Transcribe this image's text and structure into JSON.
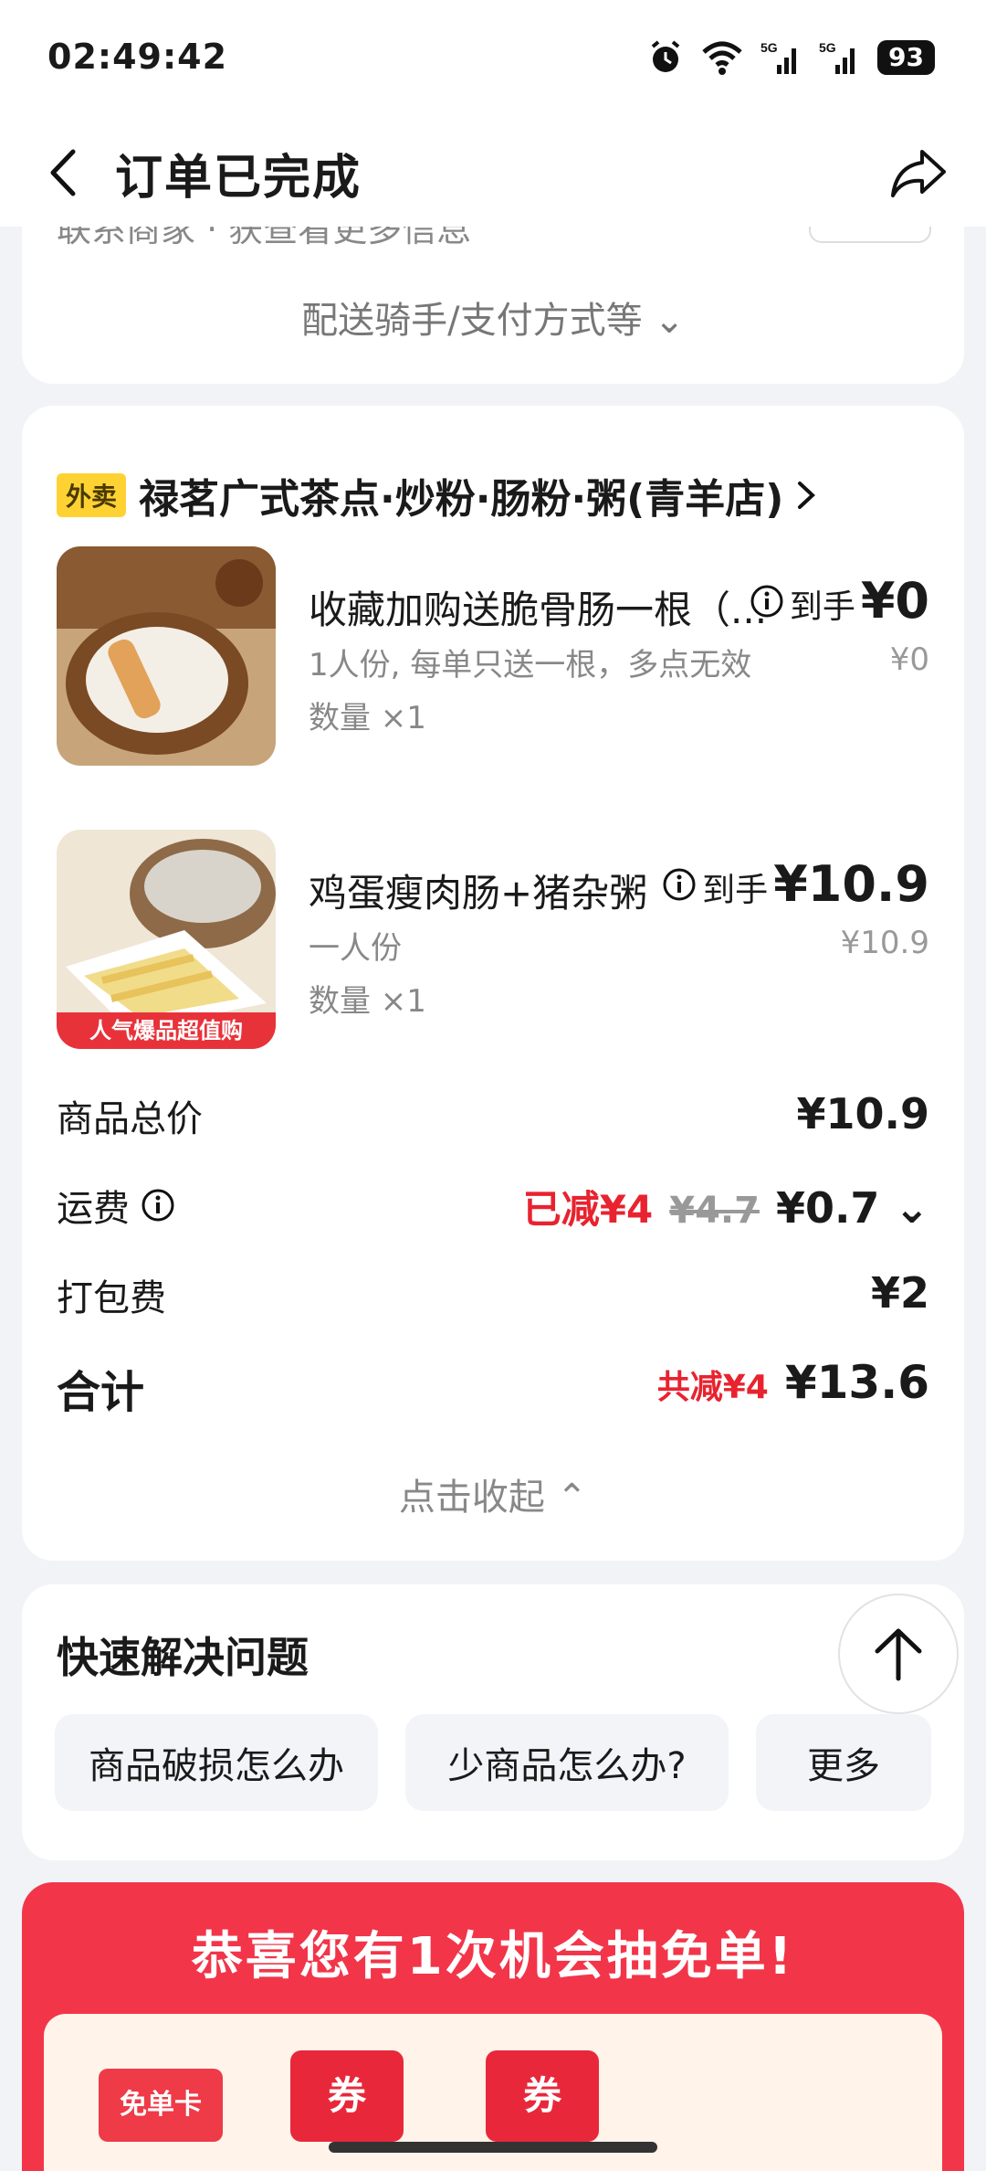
{
  "status_bar": {
    "time": "02:49:42",
    "battery": "93",
    "signal_label": "5G"
  },
  "nav": {
    "title": "订单已完成"
  },
  "top_card": {
    "cut_text": "联系商家 · 获查看更多信息",
    "delivery_toggle": "配送骑手/支付方式等 ⌄"
  },
  "order": {
    "shop_tag": "外卖",
    "shop_name": "禄茗广式茶点·炒粉·肠粉·粥(青羊店)",
    "items": [
      {
        "name": "收藏加购送脆骨肠一根（...",
        "desc": "1人份, 每单只送一根，多点无效",
        "qty": "数量 ×1",
        "daoshou": "到手",
        "price": "¥0",
        "orig_price": "¥0"
      },
      {
        "name": "鸡蛋瘦肉肠+猪杂粥",
        "desc": "一人份",
        "qty": "数量 ×1",
        "daoshou": "到手",
        "price": "¥10.9",
        "orig_price": "¥10.9",
        "badge": "人气爆品超值购"
      }
    ],
    "summary": {
      "goods_label": "商品总价",
      "goods_value": "¥10.9",
      "shipping_label": "运费",
      "shipping_discount": "已减¥4",
      "shipping_orig": "¥4.7",
      "shipping_value": "¥0.7 ⌄",
      "packing_label": "打包费",
      "packing_value": "¥2",
      "total_label": "合计",
      "total_discount": "共减¥4",
      "total_value": "¥13.6"
    },
    "collapse": "点击收起 ⌃"
  },
  "quick": {
    "title": "快速解决问题",
    "chips": [
      "商品破损怎么办",
      "少商品怎么办?",
      "更多"
    ]
  },
  "promo": {
    "title": "恭喜您有1次机会抽免单!",
    "free_card": "免单卡",
    "coupon_label": "券"
  },
  "colors": {
    "accent_red": "#e8232f",
    "tag_yellow": "#ffd233",
    "promo_red": "#f23549"
  }
}
